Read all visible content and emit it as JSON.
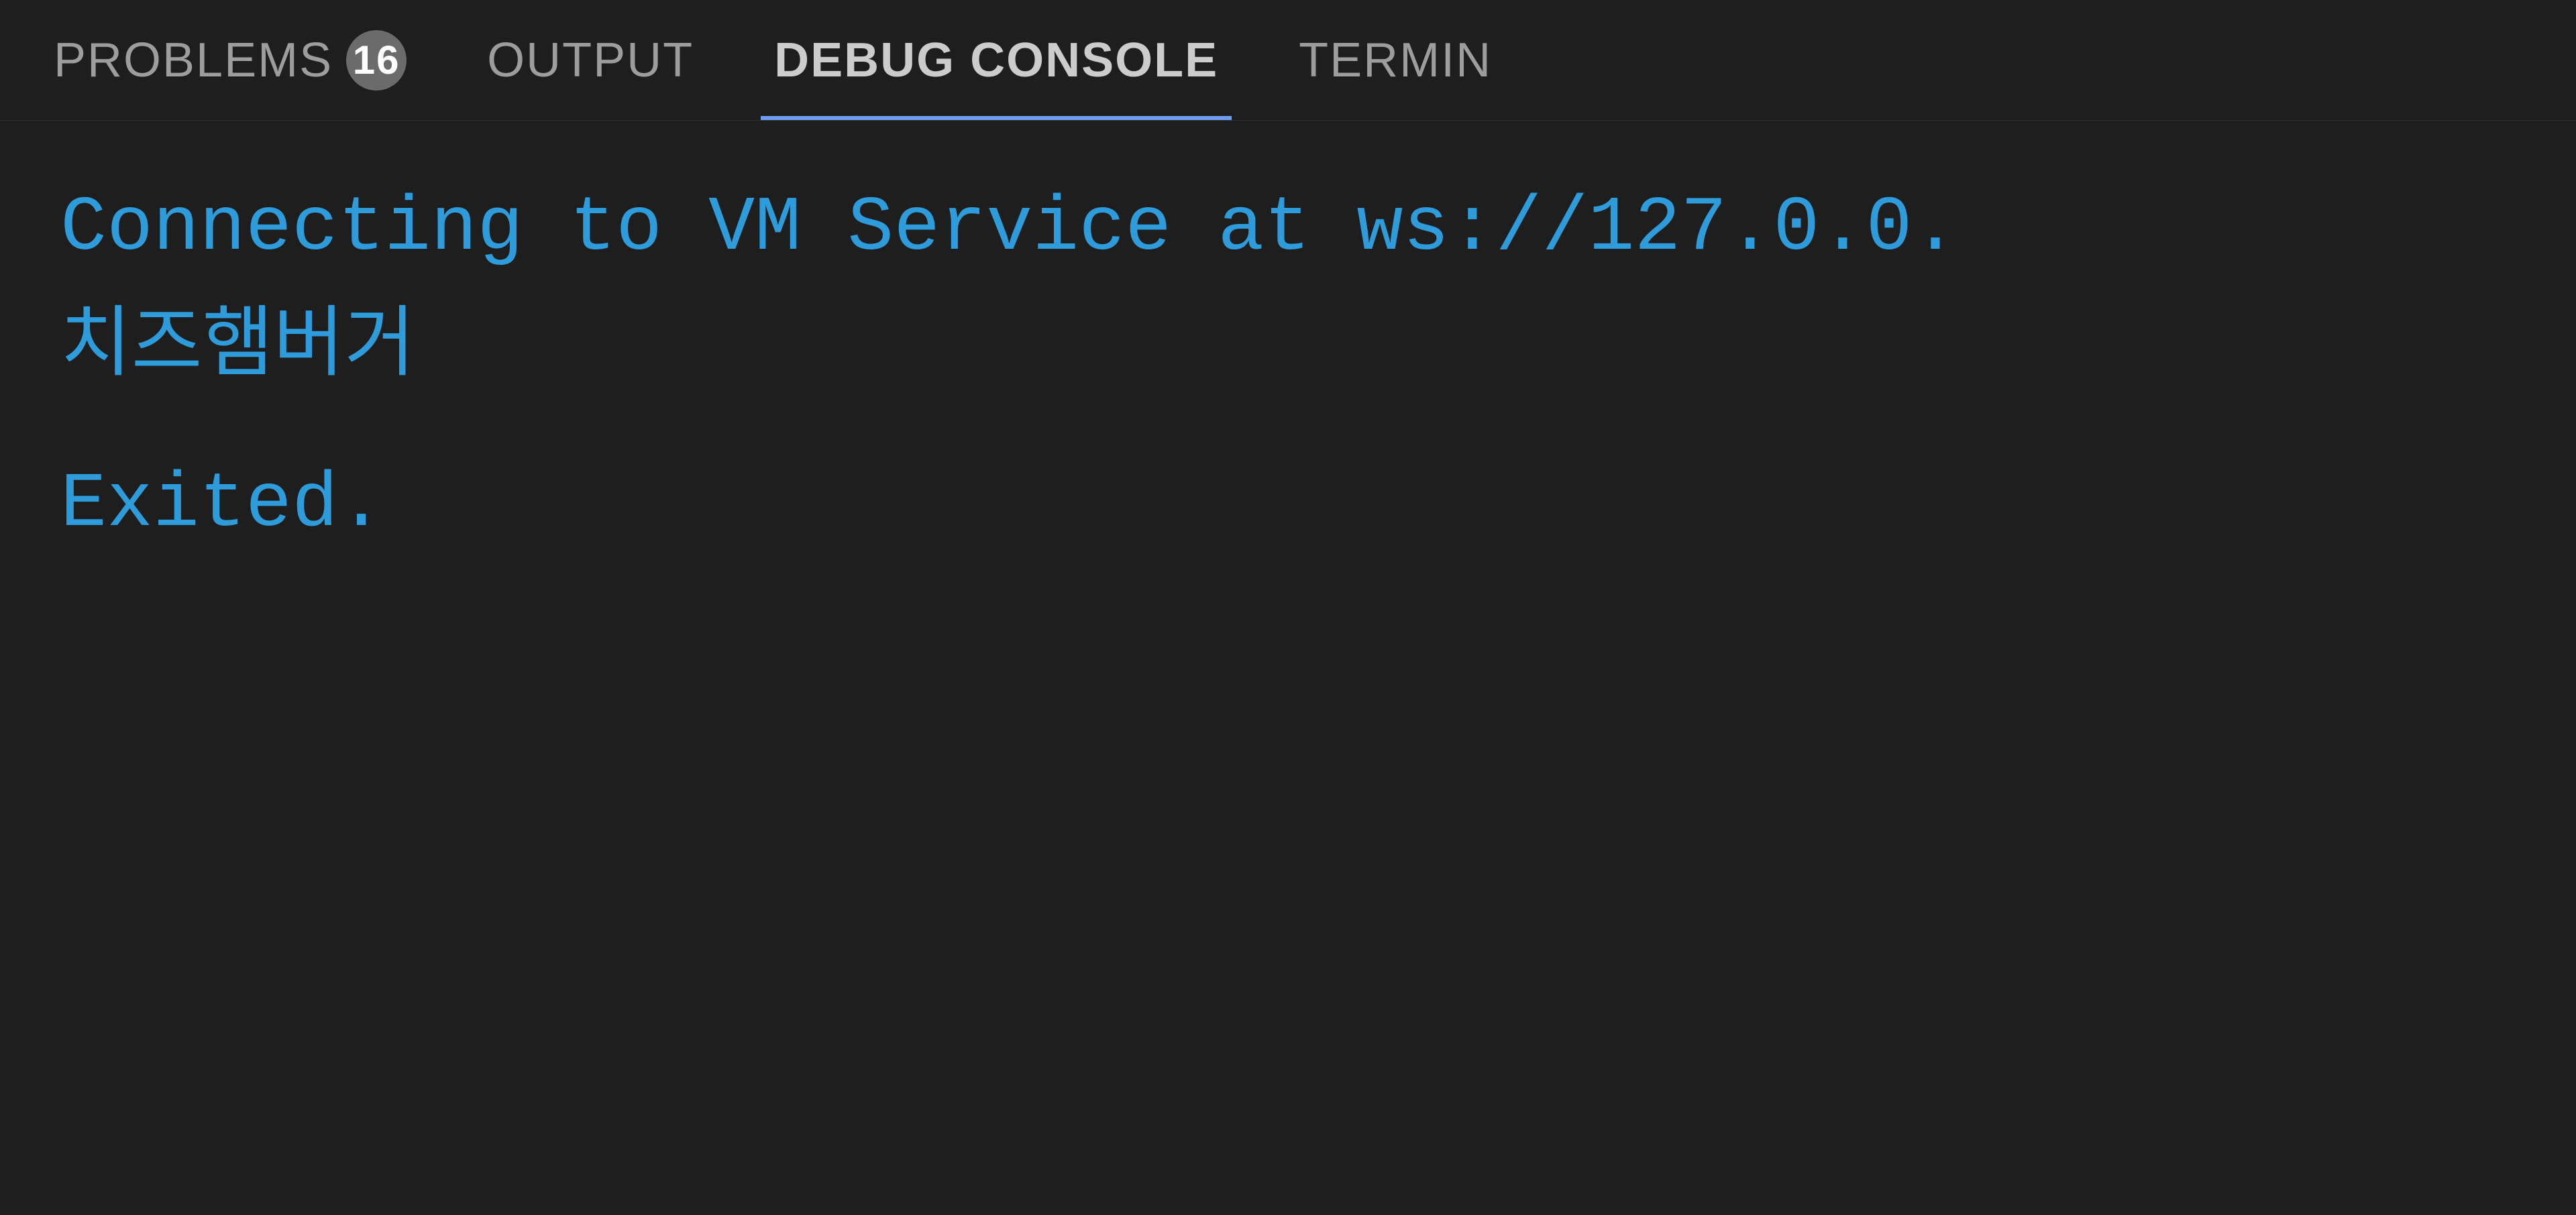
{
  "tabs": [
    {
      "id": "problems",
      "label": "PROBLEMS",
      "active": false,
      "badge": "16"
    },
    {
      "id": "output",
      "label": "OUTPUT",
      "active": false,
      "badge": null
    },
    {
      "id": "debug-console",
      "label": "DEBUG CONSOLE",
      "active": true,
      "badge": null
    },
    {
      "id": "terminal",
      "label": "TERMIN",
      "active": false,
      "badge": null
    }
  ],
  "console": {
    "line1": "Connecting to VM Service at ws://127.0.0.",
    "line2": "치즈햄버거",
    "line3": "Exited."
  },
  "colors": {
    "active_tab_underline": "#6c9ef8",
    "console_text": "#2e9bdb",
    "background": "#1e1e1e",
    "tab_inactive": "#9d9d9d",
    "tab_active": "#cccccc",
    "badge_bg": "#6b6b6b"
  }
}
